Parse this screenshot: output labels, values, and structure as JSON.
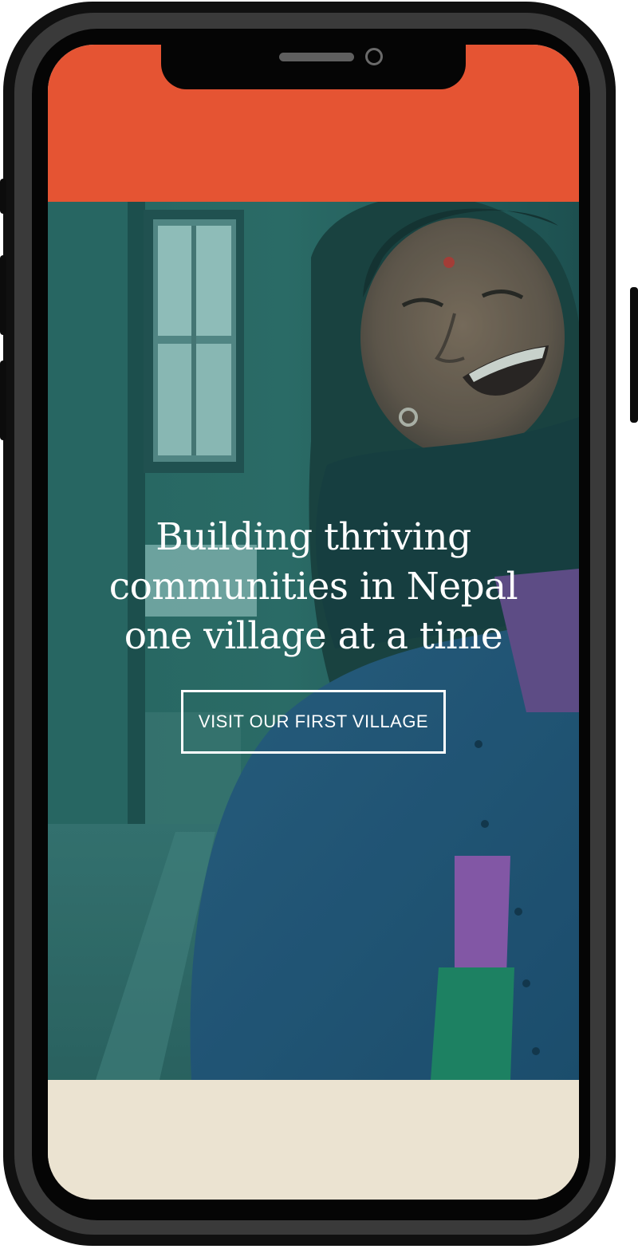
{
  "hero": {
    "headline": "Building thriving communities in Nepal one village at a time",
    "cta_label": "VISIT OUR FIRST VILLAGE",
    "photo_alt": "Smiling Nepali woman in a dark scarf and blue cardigan"
  },
  "colors": {
    "header": "#e55433",
    "hero_tint": "#2b6866",
    "footer": "#ebe3d1",
    "device": "#101010"
  }
}
